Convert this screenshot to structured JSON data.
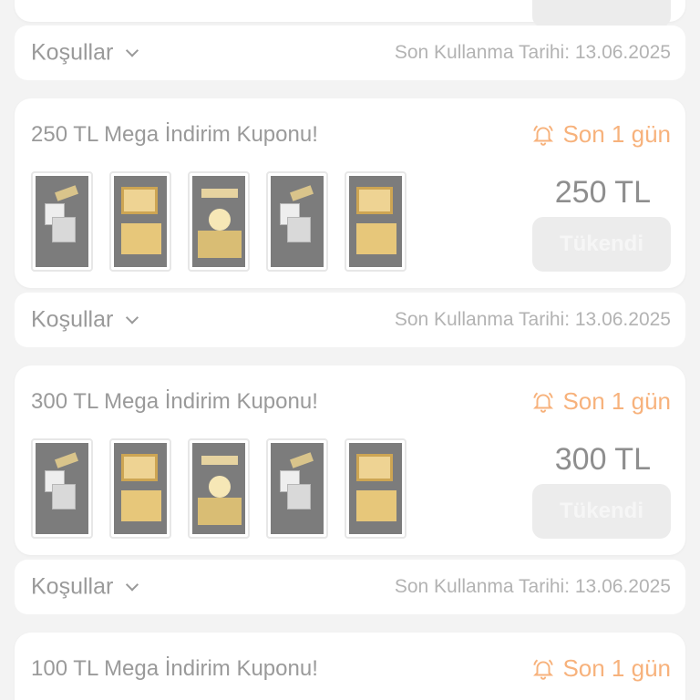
{
  "expiry_label": "Son Kullanma Tarihi: 13.06.2025",
  "conditions_label": "Koşullar",
  "button_label": "Tükendi",
  "coupons": [
    {
      "title": "250 TL Mega İndirim Kuponu!",
      "badge": "Son 1 gün",
      "price": "250 TL"
    },
    {
      "title": "300 TL Mega İndirim Kuponu!",
      "badge": "Son 1 gün",
      "price": "300 TL"
    },
    {
      "title": "100 TL Mega İndirim Kuponu!",
      "badge": "Son 1 gün"
    }
  ],
  "colors": {
    "accent_orange": "#f7b27c",
    "text_gray": "#9a9a9a",
    "background": "#f3f3f3"
  },
  "icons": {
    "badge": "bell-icon",
    "conditions": "chevron-down-icon"
  }
}
